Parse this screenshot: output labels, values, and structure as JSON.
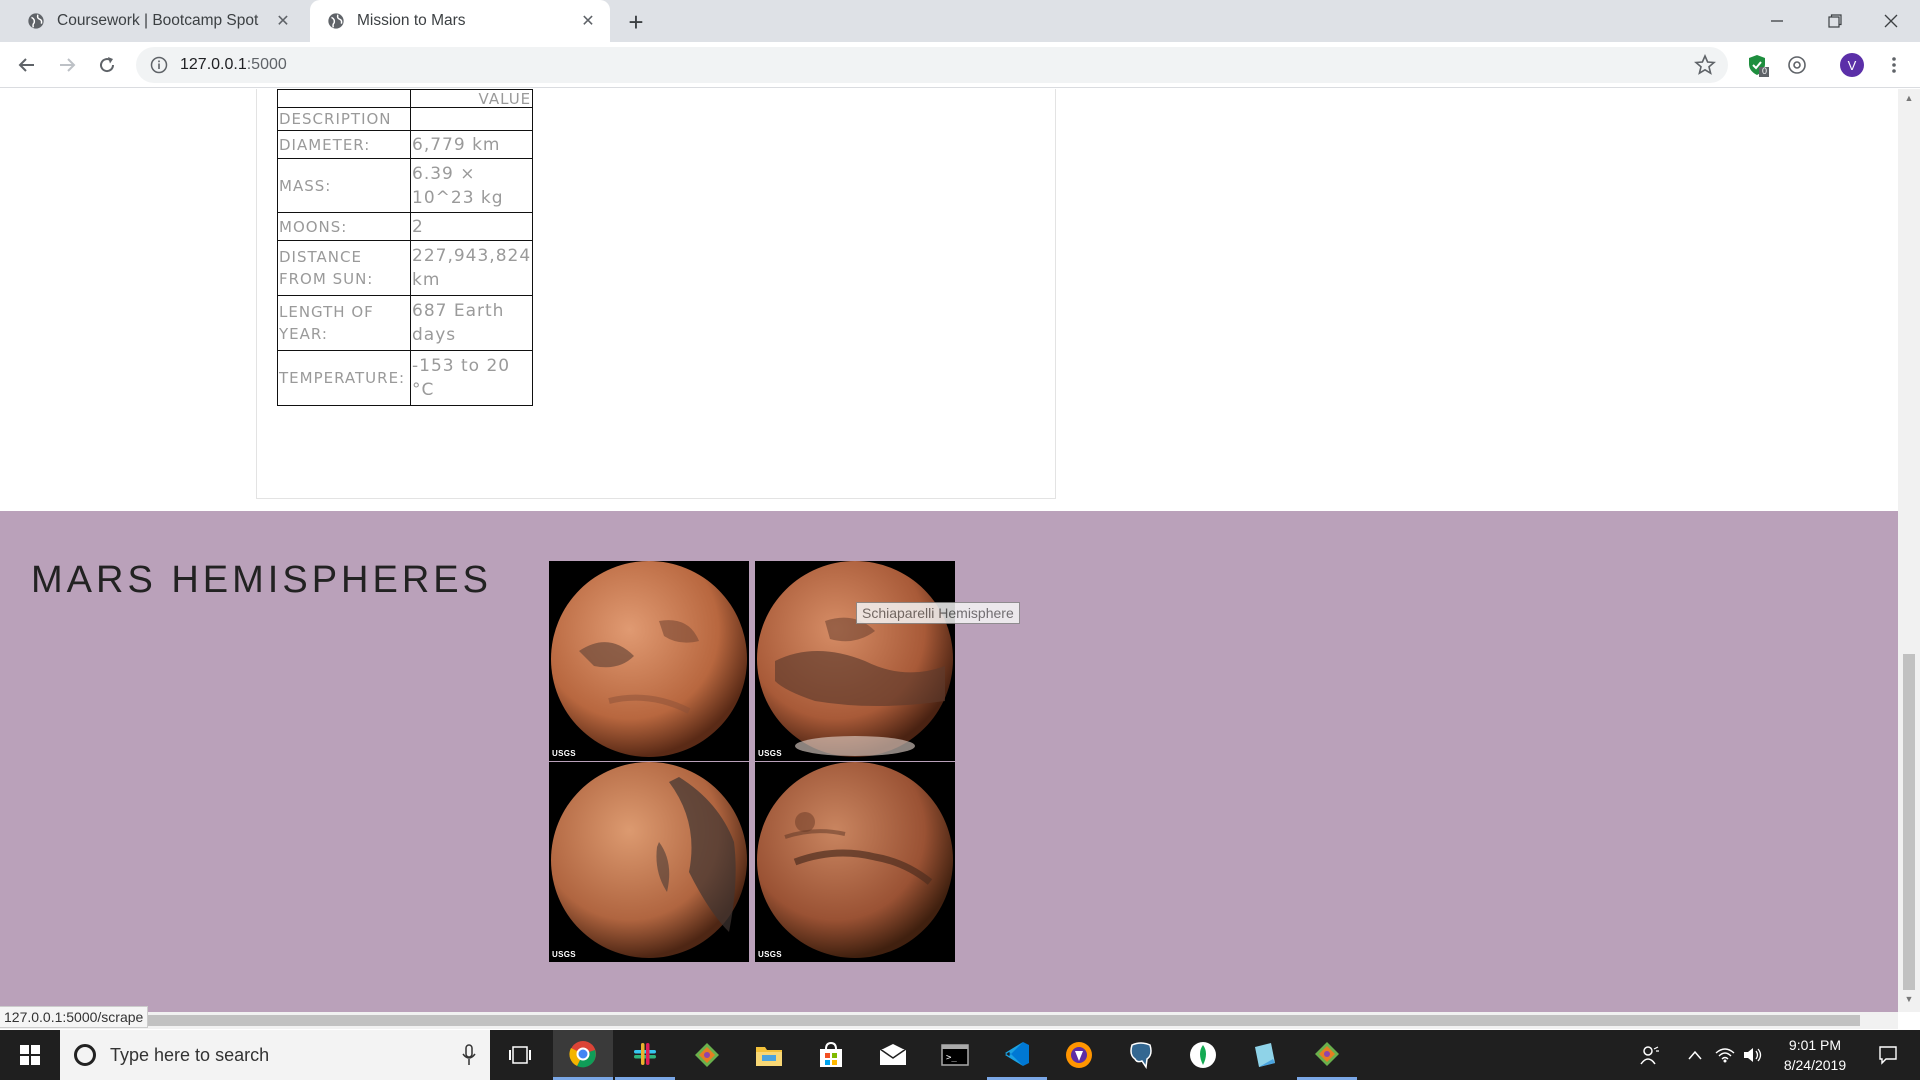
{
  "browser": {
    "tabs": [
      {
        "title": "Coursework | Bootcamp Spot",
        "active": false
      },
      {
        "title": "Mission to Mars",
        "active": true
      }
    ],
    "url_host": "127.0.0.1",
    "url_port": ":5000",
    "profile_initial": "V",
    "extension_badge": "0",
    "status_url": "127.0.0.1:5000/scrape"
  },
  "facts": {
    "header": {
      "key": "DESCRIPTION",
      "value": "VALUE"
    },
    "rows": [
      {
        "key": "DIAMETER:",
        "value": "6,779 km"
      },
      {
        "key": "MASS:",
        "value": "6.39 × 10^23 kg"
      },
      {
        "key": "MOONS:",
        "value": "2"
      },
      {
        "key": "DISTANCE FROM SUN:",
        "value": "227,943,824 km"
      },
      {
        "key": "LENGTH OF YEAR:",
        "value": "687 Earth days"
      },
      {
        "key": "TEMPERATURE:",
        "value": "-153 to 20 °C"
      }
    ]
  },
  "hemispheres": {
    "title": "MARS HEMISPHERES",
    "tooltip": "Schiaparelli Hemisphere",
    "images": [
      {
        "label": "USGS",
        "tint": "#c87a55"
      },
      {
        "label": "USGS",
        "tint": "#b86a48"
      },
      {
        "label": "USGS",
        "tint": "#c07650"
      },
      {
        "label": "USGS",
        "tint": "#a55c3c"
      }
    ]
  },
  "taskbar": {
    "search_placeholder": "Type here to search",
    "time": "9:01 PM",
    "date": "8/24/2019"
  },
  "colors": {
    "section_bg": "#baa1ba",
    "taskbar_bg": "#1f1f1f",
    "accent": "#7aa7e6",
    "profile": "#5b2fa8"
  }
}
